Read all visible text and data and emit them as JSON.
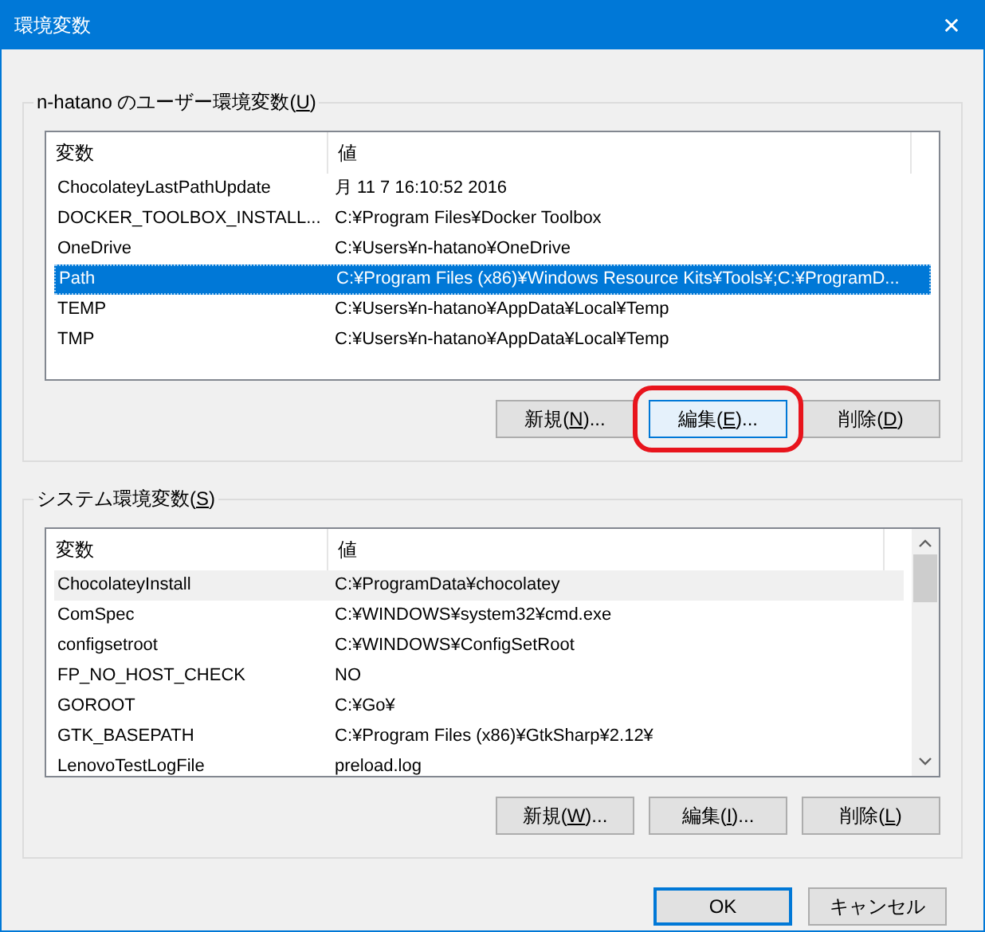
{
  "window": {
    "title": "環境変数",
    "close": "✕"
  },
  "groups": [
    {
      "title": "n-hatano のユーザー環境変数(",
      "title_key": "U",
      "title_rest": ")",
      "columns": [
        "変数",
        "値"
      ],
      "scrollbar": false,
      "rows": [
        {
          "name": "ChocolateyLastPathUpdate",
          "value": "月 11  7 16:10:52 2016",
          "selected": false
        },
        {
          "name": "DOCKER_TOOLBOX_INSTALL...",
          "value": "C:¥Program Files¥Docker Toolbox",
          "selected": false
        },
        {
          "name": "OneDrive",
          "value": "C:¥Users¥n-hatano¥OneDrive",
          "selected": false
        },
        {
          "name": "Path",
          "value": "C:¥Program Files (x86)¥Windows Resource Kits¥Tools¥;C:¥ProgramD...",
          "selected": true,
          "focused": true
        },
        {
          "name": "TEMP",
          "value": "C:¥Users¥n-hatano¥AppData¥Local¥Temp",
          "selected": false
        },
        {
          "name": "TMP",
          "value": "C:¥Users¥n-hatano¥AppData¥Local¥Temp",
          "selected": false
        }
      ],
      "buttons": [
        {
          "label": "新規(",
          "key": "N",
          "rest": ")...",
          "highlighted": false
        },
        {
          "label": "編集(",
          "key": "E",
          "rest": ")...",
          "highlighted": true
        },
        {
          "label": "削除(",
          "key": "D",
          "rest": ")",
          "highlighted": false
        }
      ]
    },
    {
      "title": "システム環境変数(",
      "title_key": "S",
      "title_rest": ")",
      "columns": [
        "変数",
        "値"
      ],
      "scrollbar": true,
      "rows": [
        {
          "name": "ChocolateyInstall",
          "value": "C:¥ProgramData¥chocolatey",
          "selected": true,
          "focused": false
        },
        {
          "name": "ComSpec",
          "value": "C:¥WINDOWS¥system32¥cmd.exe",
          "selected": false
        },
        {
          "name": "configsetroot",
          "value": "C:¥WINDOWS¥ConfigSetRoot",
          "selected": false
        },
        {
          "name": "FP_NO_HOST_CHECK",
          "value": "NO",
          "selected": false
        },
        {
          "name": "GOROOT",
          "value": "C:¥Go¥",
          "selected": false
        },
        {
          "name": "GTK_BASEPATH",
          "value": "C:¥Program Files (x86)¥GtkSharp¥2.12¥",
          "selected": false
        },
        {
          "name": "LenovoTestLogFile",
          "value": "preload.log",
          "selected": false
        }
      ],
      "buttons": [
        {
          "label": "新規(",
          "key": "W",
          "rest": ")...",
          "highlighted": false
        },
        {
          "label": "編集(",
          "key": "I",
          "rest": ")...",
          "highlighted": false
        },
        {
          "label": "削除(",
          "key": "L",
          "rest": ")",
          "highlighted": false
        }
      ]
    }
  ],
  "footer": [
    {
      "label": "OK",
      "default": true
    },
    {
      "label": "キャンセル",
      "default": false
    }
  ]
}
